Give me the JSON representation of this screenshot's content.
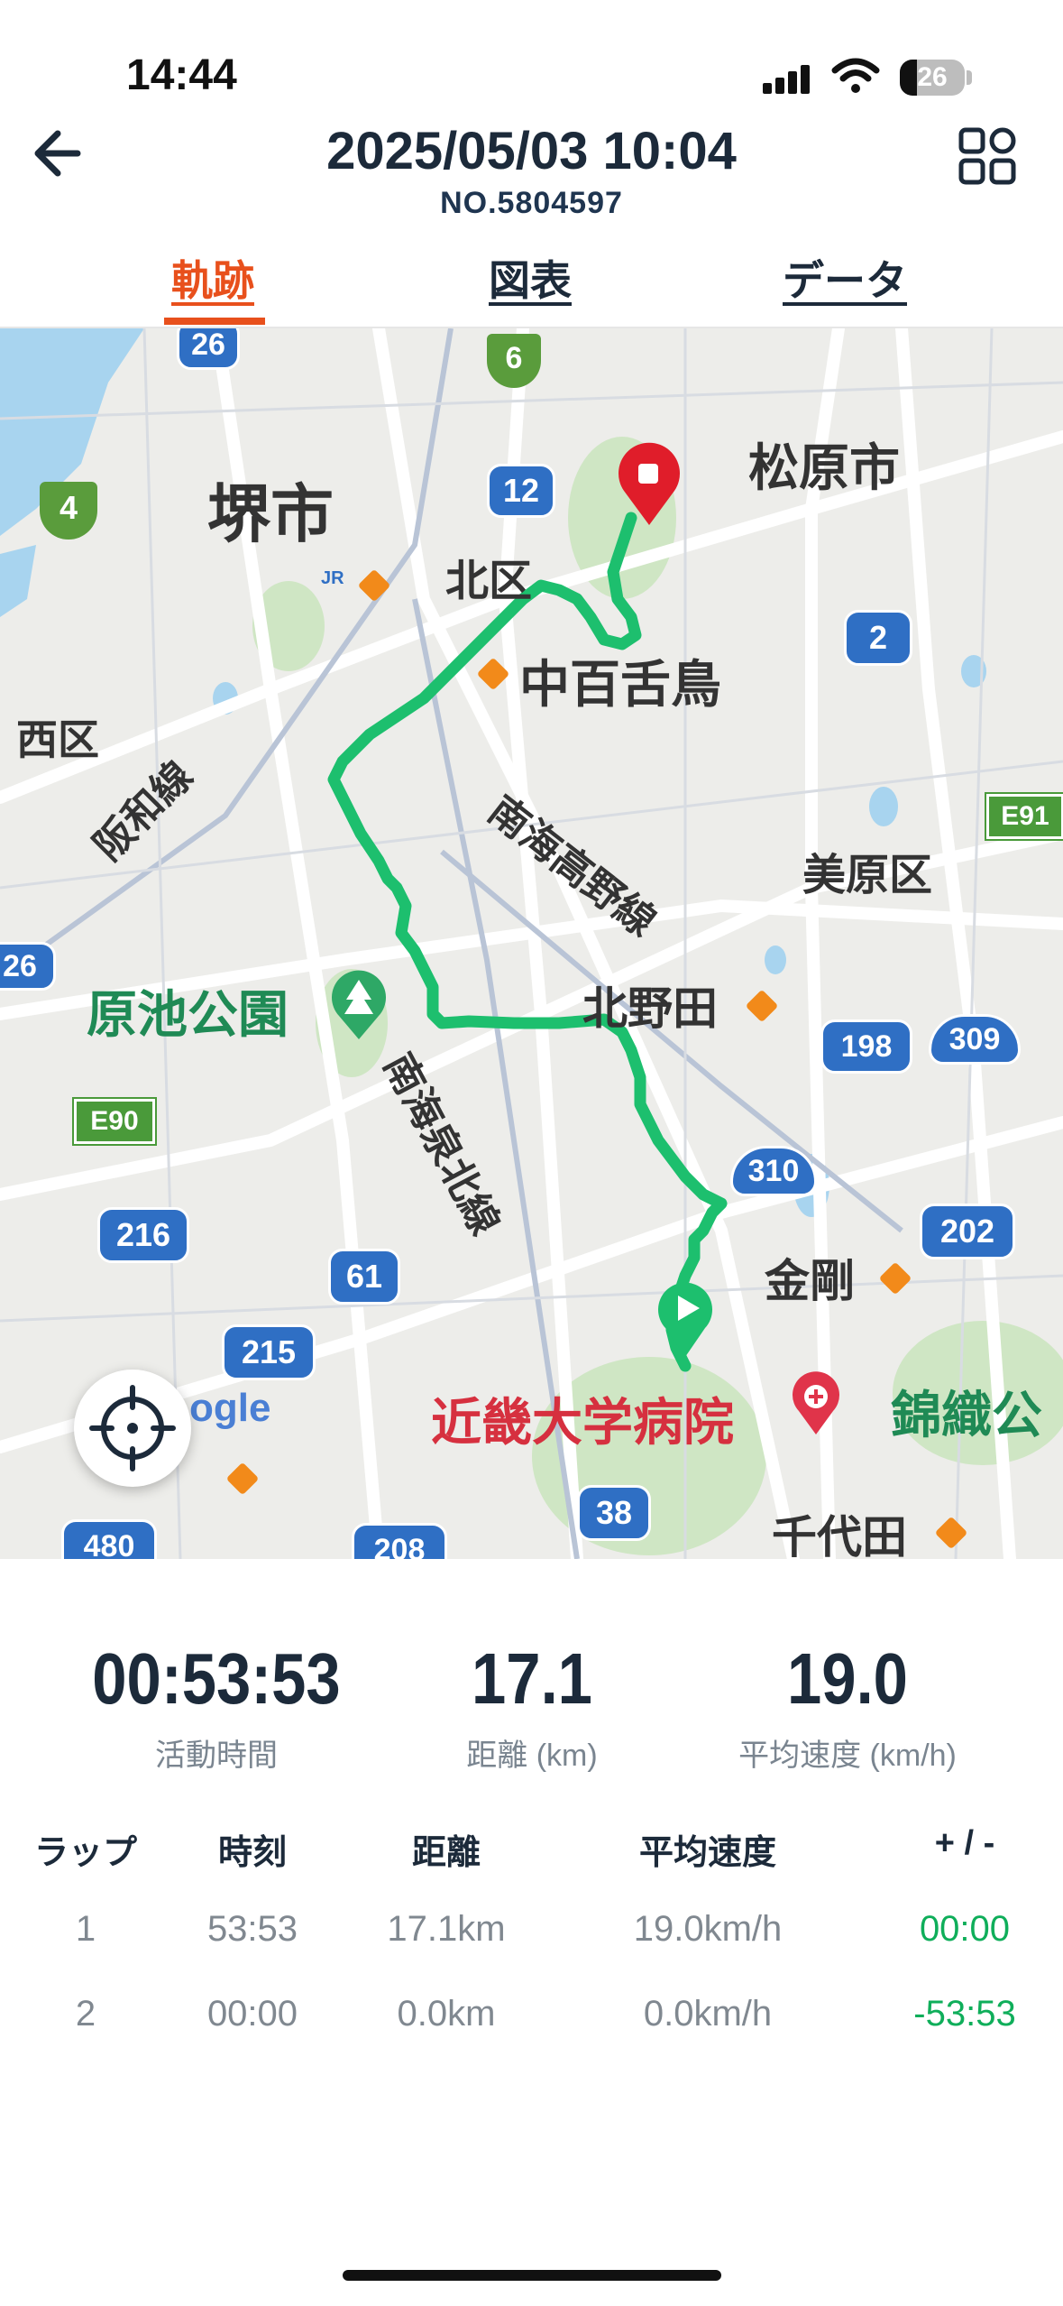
{
  "status_bar": {
    "time": "14:44",
    "battery": "26",
    "battery_level": 0.26
  },
  "header": {
    "title": "2025/05/03 10:04",
    "subtitle": "NO.5804597"
  },
  "tabs": [
    {
      "label": "軌跡",
      "active": true
    },
    {
      "label": "図表",
      "active": false
    },
    {
      "label": "データ",
      "active": false
    }
  ],
  "map": {
    "labels": {
      "sakai": "堺市",
      "matsubara": "松原市",
      "kita_ku": "北区",
      "nakamozu": "中百舌鳥",
      "nishi_ku": "西区",
      "hanwa": "阪和線",
      "nankai_koya": "南海高野線",
      "mihara": "美原区",
      "haraike": "原池公園",
      "kitanoda": "北野田",
      "nankai_senboku": "南海泉北線",
      "kongo": "金剛",
      "kindai": "近畿大学病院",
      "nishiki": "錦織公",
      "chiyoda": "千代田",
      "google": "ogle",
      "jr": "JR"
    },
    "shields": {
      "r26a": "26",
      "r6": "6",
      "r4": "4",
      "r12": "12",
      "r2": "2",
      "e91": "E91",
      "r26b": "26",
      "r198": "198",
      "r309": "309",
      "e90": "E90",
      "r310": "310",
      "r216": "216",
      "r202": "202",
      "r61": "61",
      "r215": "215",
      "r38": "38",
      "r480": "480",
      "r208": "208"
    },
    "colors": {
      "track": "#1dbf6e",
      "start": "#1dbf6e",
      "end": "#e01d2a",
      "road": "#ffffff",
      "water": "#a8d4ef",
      "park": "#cfe6c4"
    }
  },
  "stats": [
    {
      "value": "00:53:53",
      "label": "活動時間"
    },
    {
      "value": "17.1",
      "label": "距離 (km)"
    },
    {
      "value": "19.0",
      "label": "平均速度 (km/h)"
    }
  ],
  "laps": {
    "headers": [
      "ラップ",
      "時刻",
      "距離",
      "平均速度",
      "+ / -"
    ],
    "rows": [
      [
        "1",
        "53:53",
        "17.1km",
        "19.0km/h",
        "00:00"
      ],
      [
        "2",
        "00:00",
        "0.0km",
        "0.0km/h",
        "-53:53"
      ]
    ]
  },
  "colors": {
    "accent": "#e8501c",
    "text": "#1c2a3a",
    "positive": "#0fae5a"
  }
}
